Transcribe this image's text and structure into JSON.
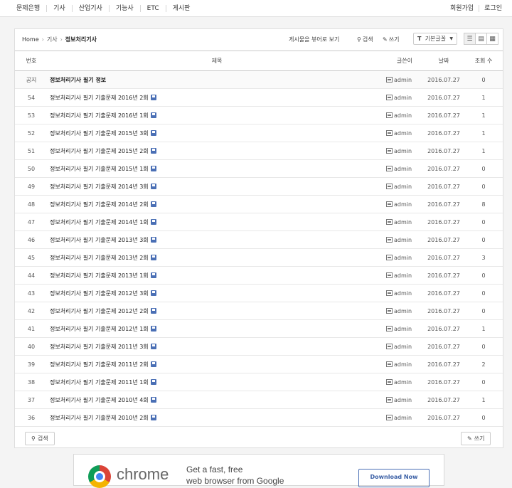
{
  "topnav": {
    "left": [
      "문제은행",
      "기사",
      "산업기사",
      "기능사",
      "ETC",
      "게시판"
    ],
    "right": [
      "회원가입",
      "로그인"
    ]
  },
  "breadcrumb": {
    "home": "Home",
    "level1": "기사",
    "current": "정보처리기사"
  },
  "toolbar": {
    "webzine": "게시물을 뷰어로 보기",
    "search": "검색",
    "write": "쓰기",
    "font_select": "기본글꼴"
  },
  "table": {
    "headers": {
      "no": "번호",
      "title": "제목",
      "author": "글쓴이",
      "date": "날짜",
      "views": "조회 수"
    },
    "notice": {
      "no": "공지",
      "title": "정보처리기사 필기 정보",
      "author": "admin",
      "date": "2016.07.27",
      "views": "0"
    },
    "rows": [
      {
        "no": "54",
        "title": "정보처리기사 필기 기출문제 2016년 2회",
        "author": "admin",
        "date": "2016.07.27",
        "views": "1"
      },
      {
        "no": "53",
        "title": "정보처리기사 필기 기출문제 2016년 1회",
        "author": "admin",
        "date": "2016.07.27",
        "views": "1"
      },
      {
        "no": "52",
        "title": "정보처리기사 필기 기출문제 2015년 3회",
        "author": "admin",
        "date": "2016.07.27",
        "views": "1"
      },
      {
        "no": "51",
        "title": "정보처리기사 필기 기출문제 2015년 2회",
        "author": "admin",
        "date": "2016.07.27",
        "views": "1"
      },
      {
        "no": "50",
        "title": "정보처리기사 필기 기출문제 2015년 1회",
        "author": "admin",
        "date": "2016.07.27",
        "views": "0"
      },
      {
        "no": "49",
        "title": "정보처리기사 필기 기출문제 2014년 3회",
        "author": "admin",
        "date": "2016.07.27",
        "views": "0"
      },
      {
        "no": "48",
        "title": "정보처리기사 필기 기출문제 2014년 2회",
        "author": "admin",
        "date": "2016.07.27",
        "views": "8"
      },
      {
        "no": "47",
        "title": "정보처리기사 필기 기출문제 2014년 1회",
        "author": "admin",
        "date": "2016.07.27",
        "views": "0"
      },
      {
        "no": "46",
        "title": "정보처리기사 필기 기출문제 2013년 3회",
        "author": "admin",
        "date": "2016.07.27",
        "views": "0"
      },
      {
        "no": "45",
        "title": "정보처리기사 필기 기출문제 2013년 2회",
        "author": "admin",
        "date": "2016.07.27",
        "views": "3"
      },
      {
        "no": "44",
        "title": "정보처리기사 필기 기출문제 2013년 1회",
        "author": "admin",
        "date": "2016.07.27",
        "views": "0"
      },
      {
        "no": "43",
        "title": "정보처리기사 필기 기출문제 2012년 3회",
        "author": "admin",
        "date": "2016.07.27",
        "views": "0"
      },
      {
        "no": "42",
        "title": "정보처리기사 필기 기출문제 2012년 2회",
        "author": "admin",
        "date": "2016.07.27",
        "views": "0"
      },
      {
        "no": "41",
        "title": "정보처리기사 필기 기출문제 2012년 1회",
        "author": "admin",
        "date": "2016.07.27",
        "views": "1"
      },
      {
        "no": "40",
        "title": "정보처리기사 필기 기출문제 2011년 3회",
        "author": "admin",
        "date": "2016.07.27",
        "views": "0"
      },
      {
        "no": "39",
        "title": "정보처리기사 필기 기출문제 2011년 2회",
        "author": "admin",
        "date": "2016.07.27",
        "views": "2"
      },
      {
        "no": "38",
        "title": "정보처리기사 필기 기출문제 2011년 1회",
        "author": "admin",
        "date": "2016.07.27",
        "views": "0"
      },
      {
        "no": "37",
        "title": "정보처리기사 필기 기출문제 2010년 4회",
        "author": "admin",
        "date": "2016.07.27",
        "views": "1"
      },
      {
        "no": "36",
        "title": "정보처리기사 필기 기출문제 2010년 2회",
        "author": "admin",
        "date": "2016.07.27",
        "views": "0"
      }
    ]
  },
  "footer": {
    "search": "검색",
    "write": "쓰기"
  },
  "ad": {
    "brand": "chrome",
    "line1": "Get a fast, free",
    "line2": "web browser from Google",
    "button": "Download Now"
  }
}
